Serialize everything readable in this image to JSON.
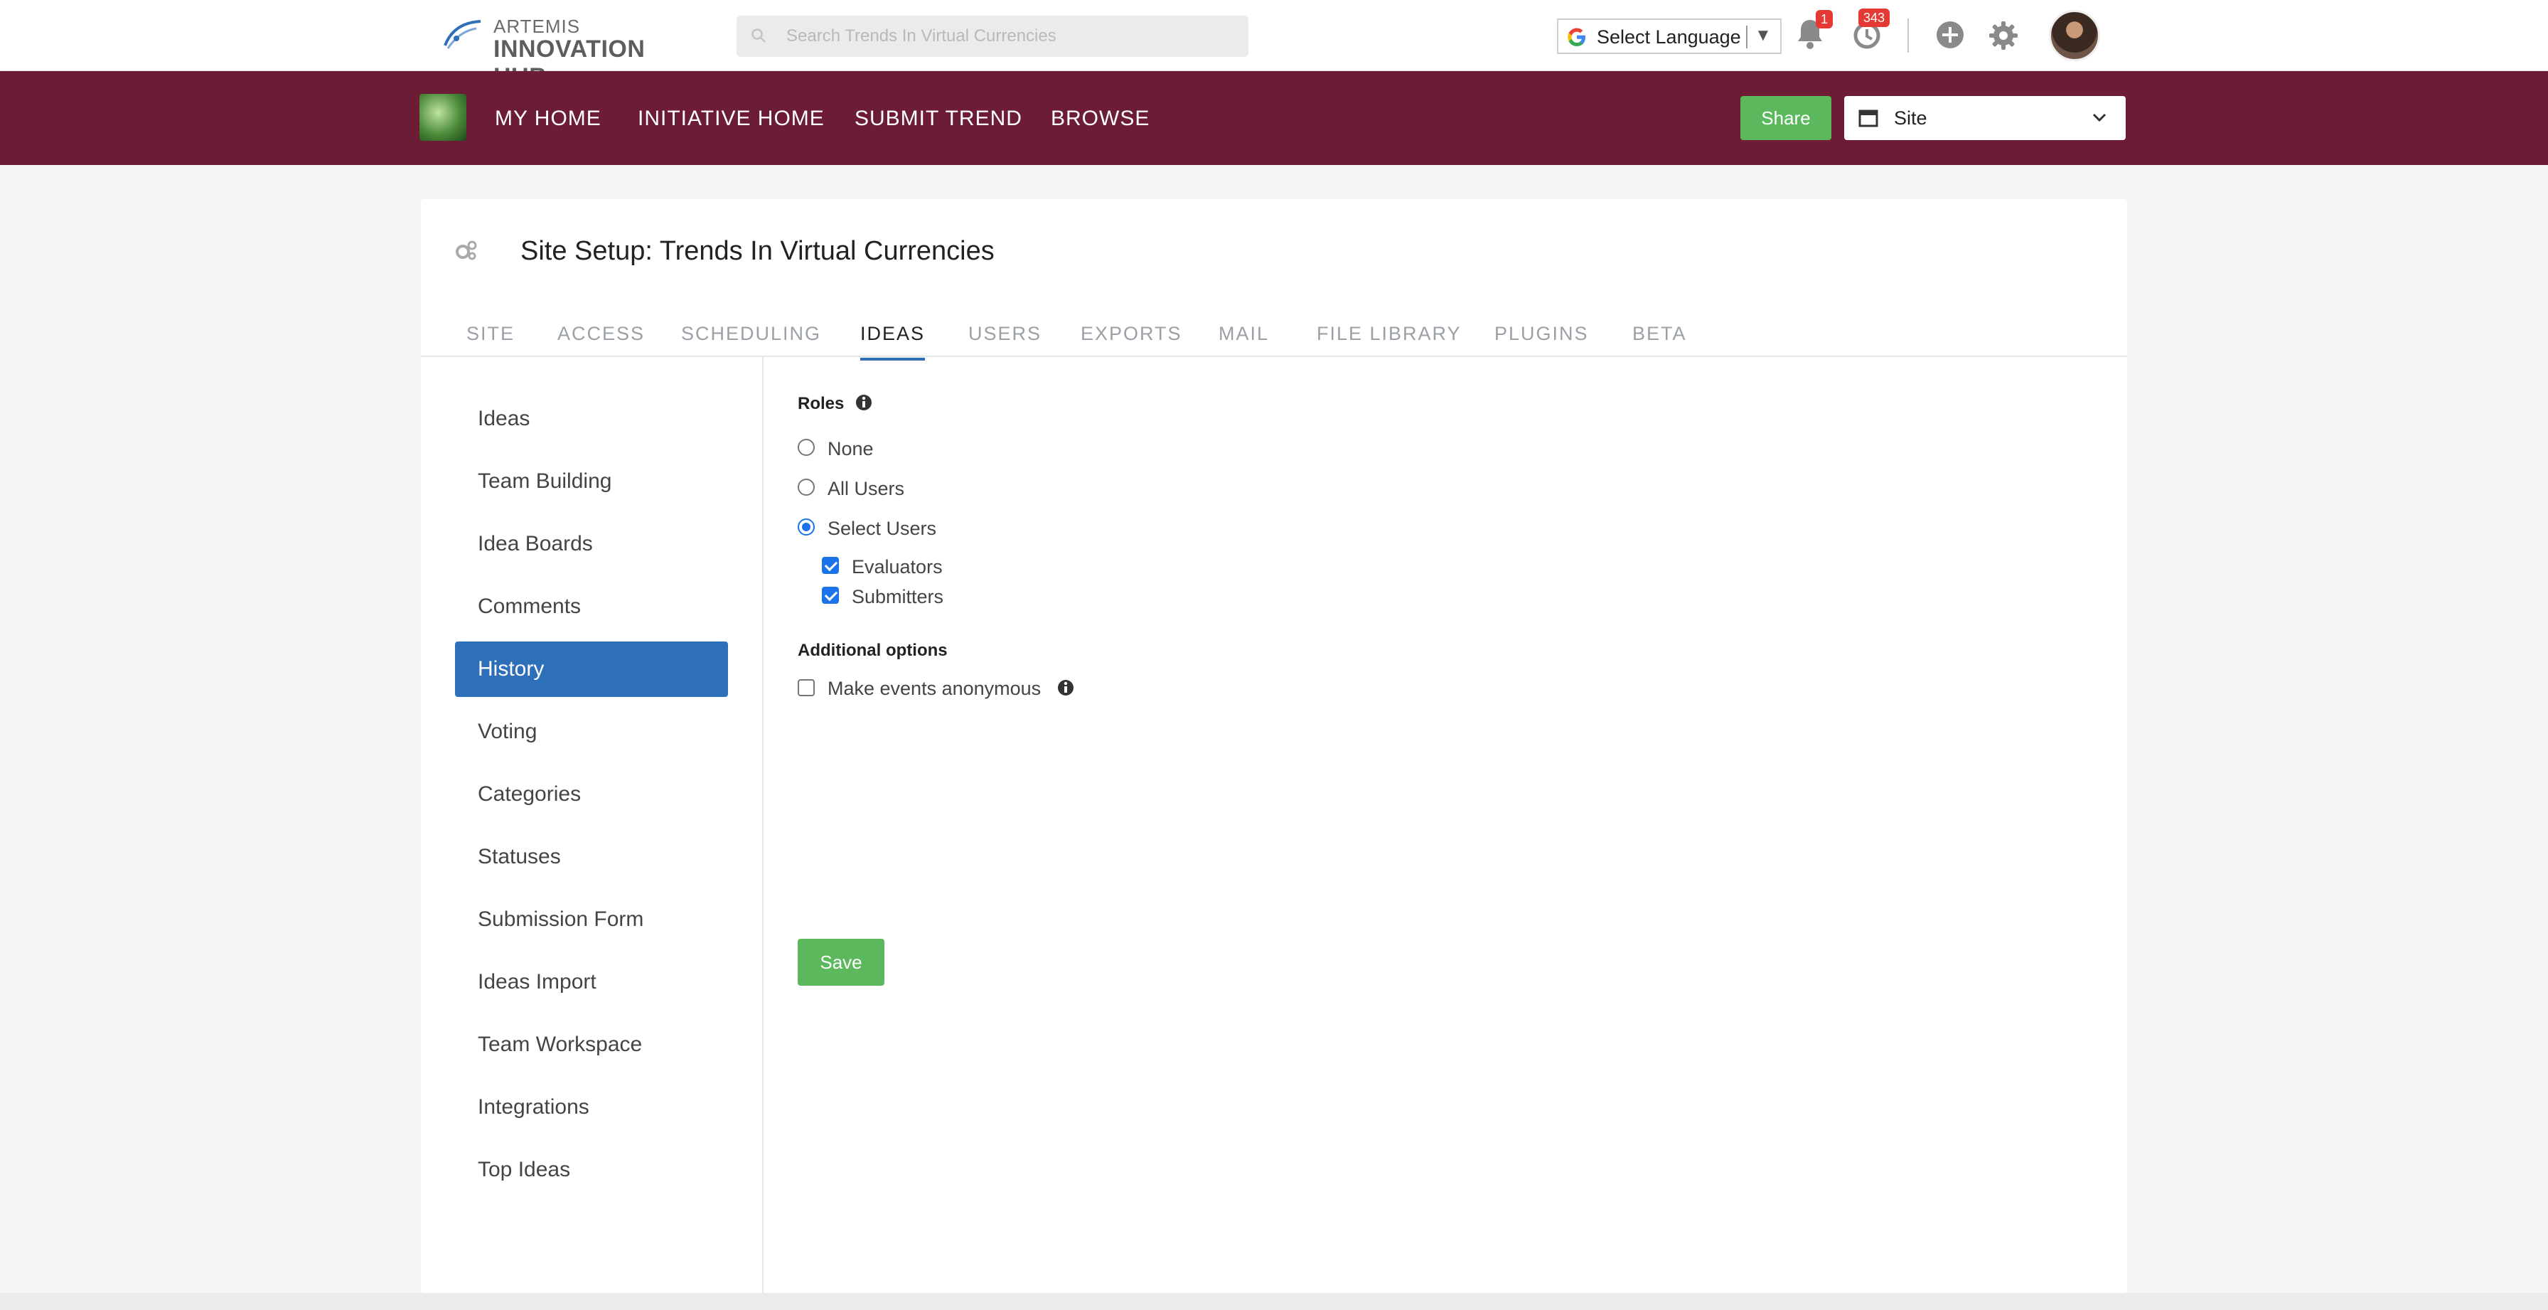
{
  "brand": {
    "line1": "ARTEMIS",
    "line2": "INNOVATION HUB"
  },
  "search": {
    "placeholder": "Search Trends In Virtual Currencies"
  },
  "language": {
    "label": "Select Language"
  },
  "notifications": {
    "count": "1"
  },
  "history_badge": {
    "count": "343"
  },
  "nav": {
    "links": [
      "MY HOME",
      "INITIATIVE HOME",
      "SUBMIT TREND",
      "BROWSE"
    ],
    "share_label": "Share",
    "site_select": "Site"
  },
  "page": {
    "title": "Site Setup: Trends In Virtual Currencies",
    "tabs": [
      "SITE",
      "ACCESS",
      "SCHEDULING",
      "IDEAS",
      "USERS",
      "EXPORTS",
      "MAIL",
      "FILE LIBRARY",
      "PLUGINS",
      "BETA"
    ],
    "active_tab": "IDEAS"
  },
  "sidebar": {
    "items": [
      "Ideas",
      "Team Building",
      "Idea Boards",
      "Comments",
      "History",
      "Voting",
      "Categories",
      "Statuses",
      "Submission Form",
      "Ideas Import",
      "Team Workspace",
      "Integrations",
      "Top Ideas"
    ],
    "active": "History"
  },
  "form": {
    "roles_title": "Roles",
    "radios": [
      "None",
      "All Users",
      "Select Users"
    ],
    "selected_radio": "Select Users",
    "checkboxes": [
      "Evaluators",
      "Submitters"
    ],
    "additional_title": "Additional options",
    "anonymous_label": "Make events anonymous",
    "save_label": "Save"
  },
  "colors": {
    "nav_bg": "#6d1c36",
    "accent_blue": "#2d6fb8",
    "success_green": "#5cb85c",
    "badge_red": "#e53935"
  }
}
